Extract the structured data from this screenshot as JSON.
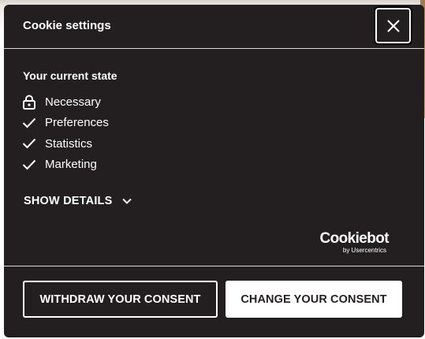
{
  "dialog": {
    "title": "Cookie settings",
    "close_icon": "close-icon"
  },
  "current_state": {
    "heading": "Your current state",
    "items": [
      {
        "label": "Necessary",
        "icon": "lock-icon"
      },
      {
        "label": "Preferences",
        "icon": "checkmark-icon"
      },
      {
        "label": "Statistics",
        "icon": "checkmark-icon"
      },
      {
        "label": "Marketing",
        "icon": "checkmark-icon"
      }
    ]
  },
  "details": {
    "label": "SHOW DETAILS",
    "icon": "chevron-down-icon"
  },
  "branding": {
    "name": "Cookiebot",
    "sub": "by Usercentrics"
  },
  "actions": {
    "withdraw_label": "WITHDRAW YOUR CONSENT",
    "change_label": "CHANGE YOUR CONSENT"
  },
  "colors": {
    "dialog_bg": "#231f20",
    "text": "#ffffff",
    "divider": "#d9d9d9"
  }
}
